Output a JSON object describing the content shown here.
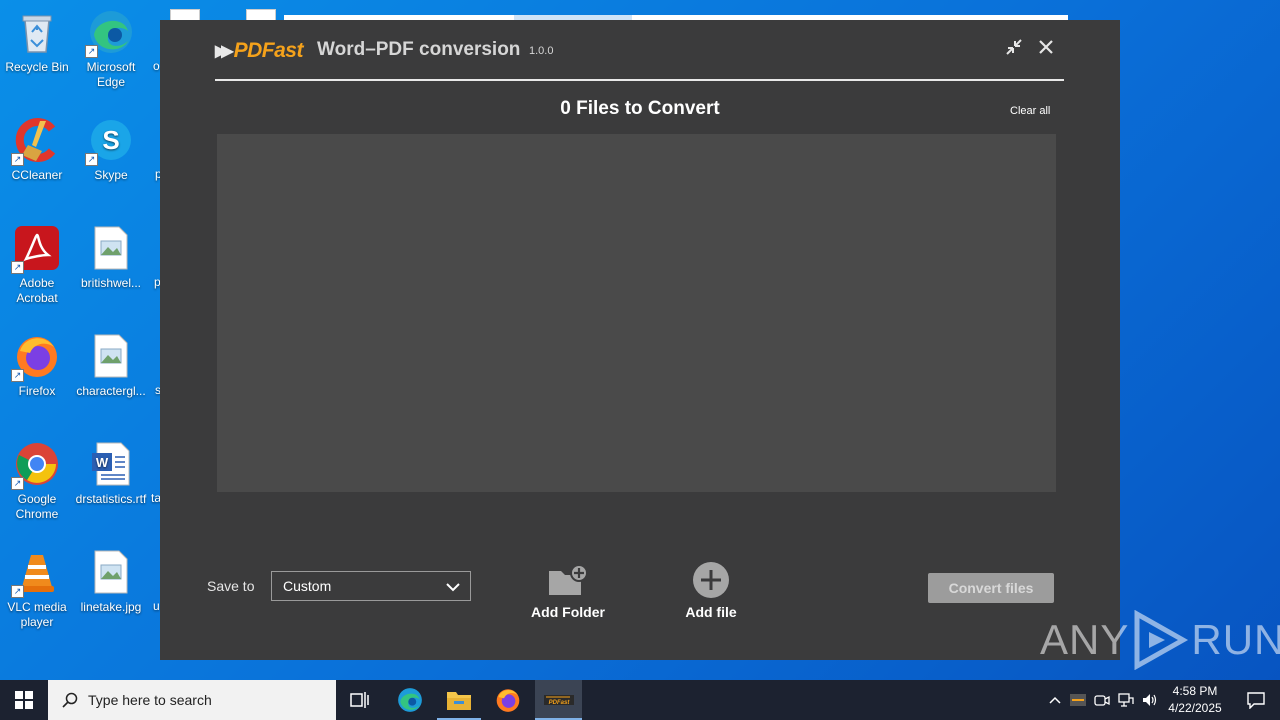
{
  "desktop": {
    "icons": [
      {
        "label": "Recycle Bin"
      },
      {
        "label": "Microsoft Edge"
      },
      {
        "label": "CCleaner"
      },
      {
        "label": "Skype"
      },
      {
        "label": "Adobe Acrobat"
      },
      {
        "label": "britishwel..."
      },
      {
        "label": "Firefox"
      },
      {
        "label": "charactergl..."
      },
      {
        "label": "Google Chrome"
      },
      {
        "label": "drstatistics.rtf"
      },
      {
        "label": "VLC media player"
      },
      {
        "label": "linetake.jpg"
      }
    ],
    "partial_labels": [
      "o",
      "p",
      "p",
      "s",
      "ta",
      "u"
    ]
  },
  "app": {
    "logo_text": "PDFast",
    "title": "Word–PDF conversion",
    "version": "1.0.0",
    "files_heading": "0 Files to Convert",
    "clear_all_label": "Clear all",
    "save_to_label": "Save to",
    "save_to_value": "Custom",
    "add_folder_label": "Add Folder",
    "add_file_label": "Add file",
    "convert_label": "Convert files",
    "accent_color": "#f5a21b"
  },
  "watermark": {
    "left": "ANY",
    "right": "RUN"
  },
  "taskbar": {
    "search_placeholder": "Type here to search",
    "clock_time": "4:58 PM",
    "clock_date": "4/22/2025"
  }
}
